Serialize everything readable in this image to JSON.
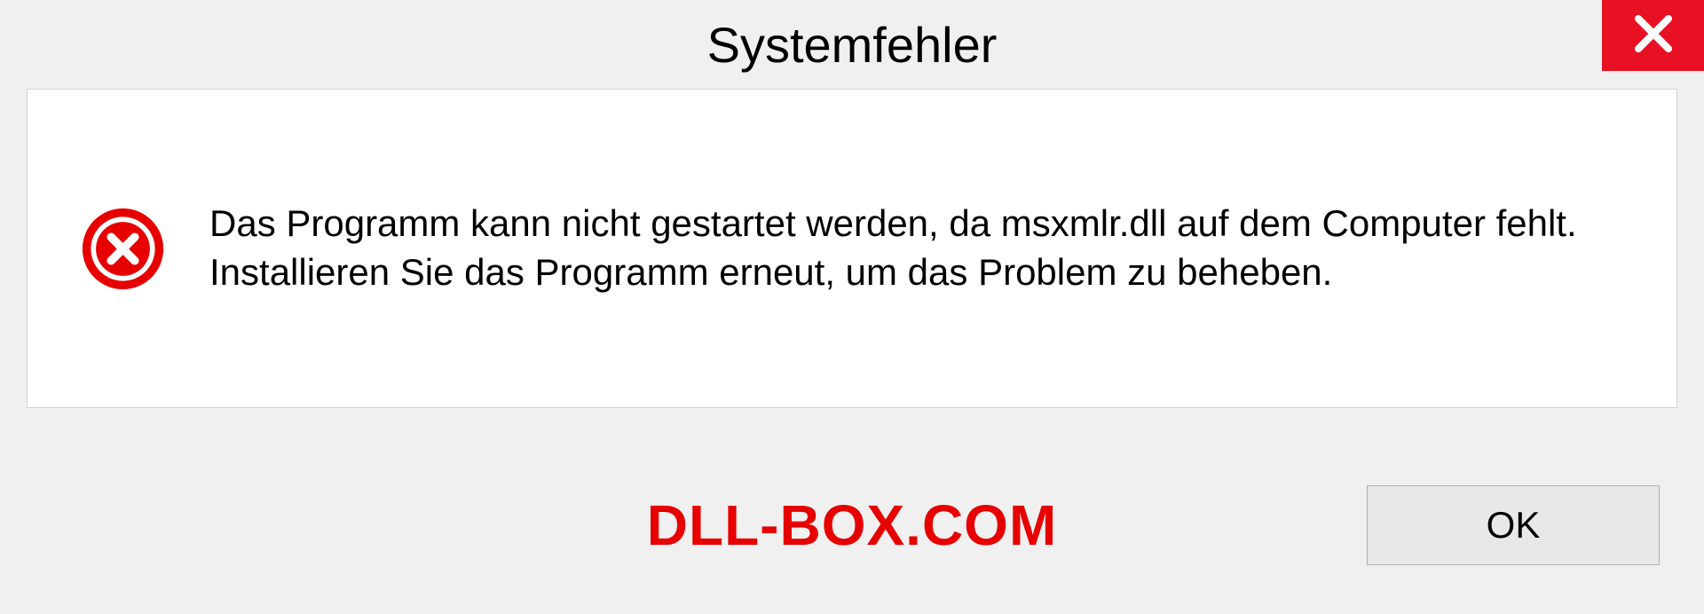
{
  "dialog": {
    "title": "Systemfehler",
    "message": "Das Programm kann nicht gestartet werden, da msxmlr.dll auf dem Computer fehlt. Installieren Sie das Programm erneut, um das Problem zu beheben.",
    "ok_label": "OK"
  },
  "watermark": "DLL-BOX.COM",
  "icons": {
    "close": "close-icon",
    "error": "error-icon"
  },
  "colors": {
    "close_bg": "#e81123",
    "error_red": "#e60000",
    "dialog_bg": "#f0f0f0",
    "content_bg": "#ffffff"
  }
}
